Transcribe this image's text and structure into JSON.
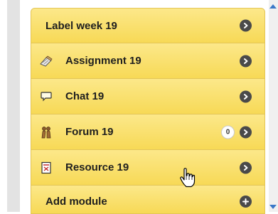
{
  "modules": {
    "rows": [
      {
        "label": "Label week 19",
        "icon": "none",
        "badge": null,
        "action": "arrow-right-icon"
      },
      {
        "label": "Assignment 19",
        "icon": "assignment-icon",
        "badge": null,
        "action": "arrow-right-icon"
      },
      {
        "label": "Chat 19",
        "icon": "chat-icon",
        "badge": null,
        "action": "arrow-right-icon"
      },
      {
        "label": "Forum 19",
        "icon": "forum-icon",
        "badge": "0",
        "action": "arrow-right-icon"
      },
      {
        "label": "Resource 19",
        "icon": "resource-icon",
        "badge": null,
        "action": "arrow-right-icon"
      },
      {
        "label": "Add module",
        "icon": "none",
        "badge": null,
        "action": "plus-icon"
      }
    ]
  },
  "colors": {
    "row_background": "#f9e27a",
    "row_border": "#e3c558",
    "action_button": "#4a4a4a",
    "scroll_arrow": "#3a78c8"
  },
  "cursor": "hand-pointer-icon"
}
